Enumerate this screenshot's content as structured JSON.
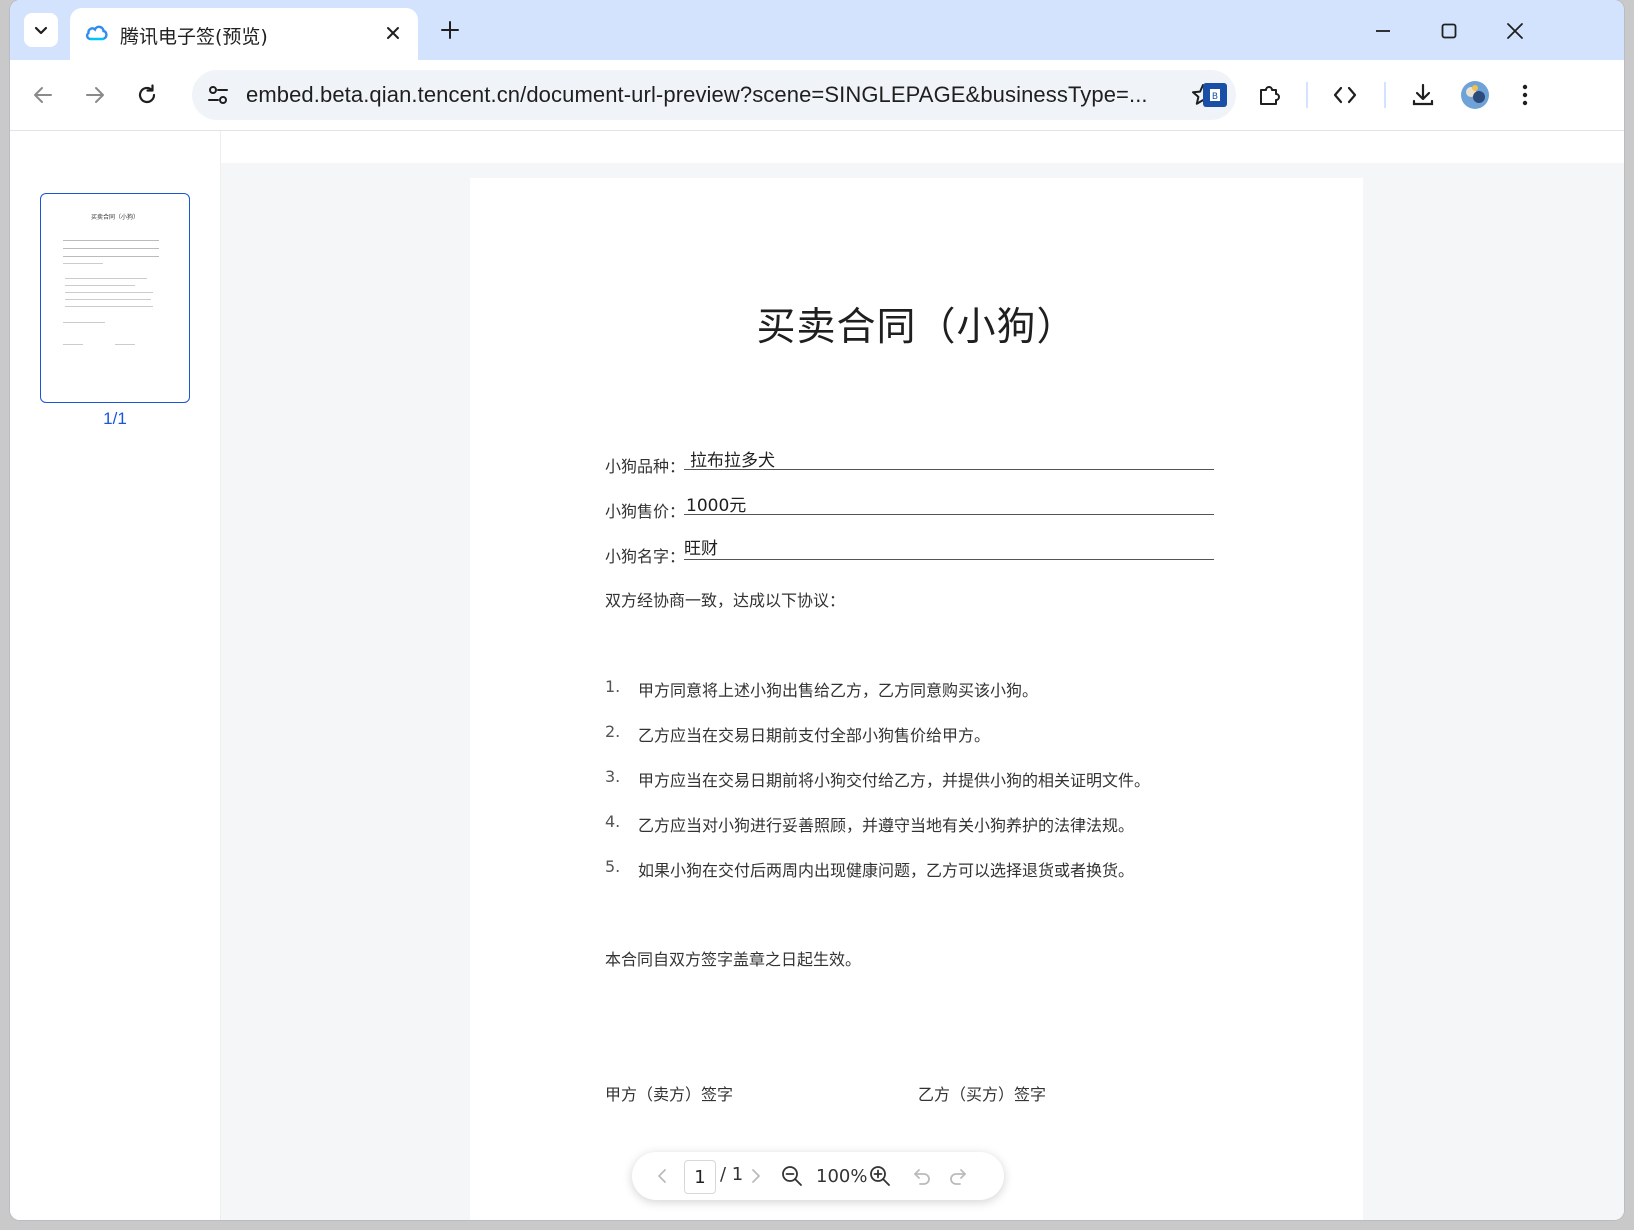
{
  "browser": {
    "tab_title": "腾讯电子签(预览)",
    "url": "embed.beta.qian.tencent.cn/document-url-preview?scene=SINGLEPAGE&businessType=...",
    "accent_color": "#d3e3fd"
  },
  "thumbnails": {
    "page_label": "1/1",
    "mini_title": "买卖合同（小狗）"
  },
  "document": {
    "title": "买卖合同（小狗）",
    "fields": [
      {
        "label": "小狗品种：",
        "value": "拉布拉多犬"
      },
      {
        "label": "小狗售价：",
        "value": "1000元"
      },
      {
        "label": "小狗名字：",
        "value": "旺财"
      }
    ],
    "intro": "双方经协商一致，达成以下协议：",
    "clauses": [
      {
        "num": "1.",
        "text": "甲方同意将上述小狗出售给乙方，乙方同意购买该小狗。"
      },
      {
        "num": "2.",
        "text": "乙方应当在交易日期前支付全部小狗售价给甲方。"
      },
      {
        "num": "3.",
        "text": "甲方应当在交易日期前将小狗交付给乙方，并提供小狗的相关证明文件。"
      },
      {
        "num": "4.",
        "text": "乙方应当对小狗进行妥善照顾，并遵守当地有关小狗养护的法律法规。"
      },
      {
        "num": "5.",
        "text": "如果小狗在交付后两周内出现健康问题，乙方可以选择退货或者换货。"
      }
    ],
    "effective": "本合同自双方签字盖章之日起生效。",
    "party_a_sign": "甲方（卖方）签字",
    "party_b_sign": "乙方（买方）签字"
  },
  "pager": {
    "current_page": "1",
    "total": "/ 1",
    "zoom": "100%"
  }
}
